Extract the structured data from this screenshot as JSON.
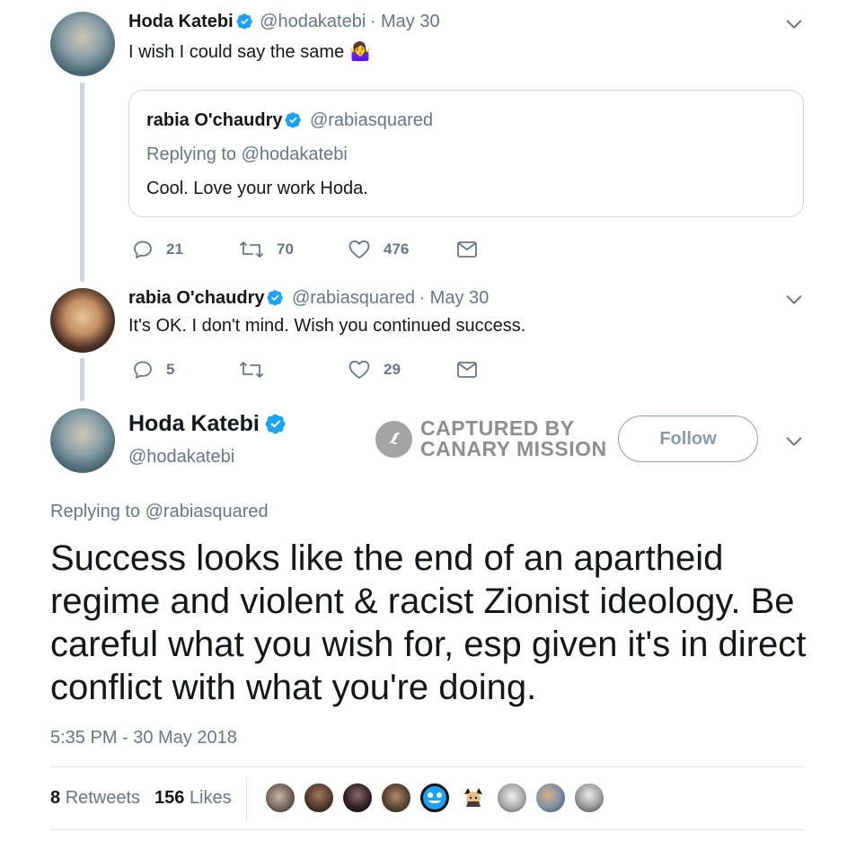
{
  "tweet1": {
    "name": "Hoda Katebi",
    "handle": "@hodakatebi",
    "date": "· May 30",
    "text": "I wish I could say the same",
    "emoji": "🤷‍♀️"
  },
  "quote": {
    "name": "rabia O'chaudry",
    "handle": "@rabiasquared",
    "replying_prefix": "Replying to",
    "replying_handle": "@hodakatebi",
    "text": "Cool. Love your work Hoda."
  },
  "tweet1_actions": {
    "replies": "21",
    "retweets": "70",
    "likes": "476"
  },
  "tweet2": {
    "name": "rabia O'chaudry",
    "handle": "@rabiasquared",
    "date": "· May 30",
    "text": "It's OK. I don't mind. Wish you continued success."
  },
  "tweet2_actions": {
    "replies": "5",
    "retweets": "",
    "likes": "29"
  },
  "main": {
    "name": "Hoda Katebi",
    "handle": "@hodakatebi",
    "follow_label": "Follow",
    "replying_prefix": "Replying to",
    "replying_handle": "@rabiasquared",
    "text": "Success looks like the end of an apartheid regime and violent & racist Zionist ideology. Be careful what you wish for, esp given it's in direct conflict with what you're doing.",
    "timestamp": "5:35 PM - 30 May 2018",
    "retweets_count": "8",
    "retweets_label": "Retweets",
    "likes_count": "156",
    "likes_label": "Likes"
  },
  "watermark": {
    "line1": "CAPTURED BY",
    "line2": "CANARY MISSION"
  },
  "colors": {
    "verified": "#1da1f2",
    "muted": "#657786",
    "text": "#14171a",
    "border": "#ccd6dd"
  }
}
